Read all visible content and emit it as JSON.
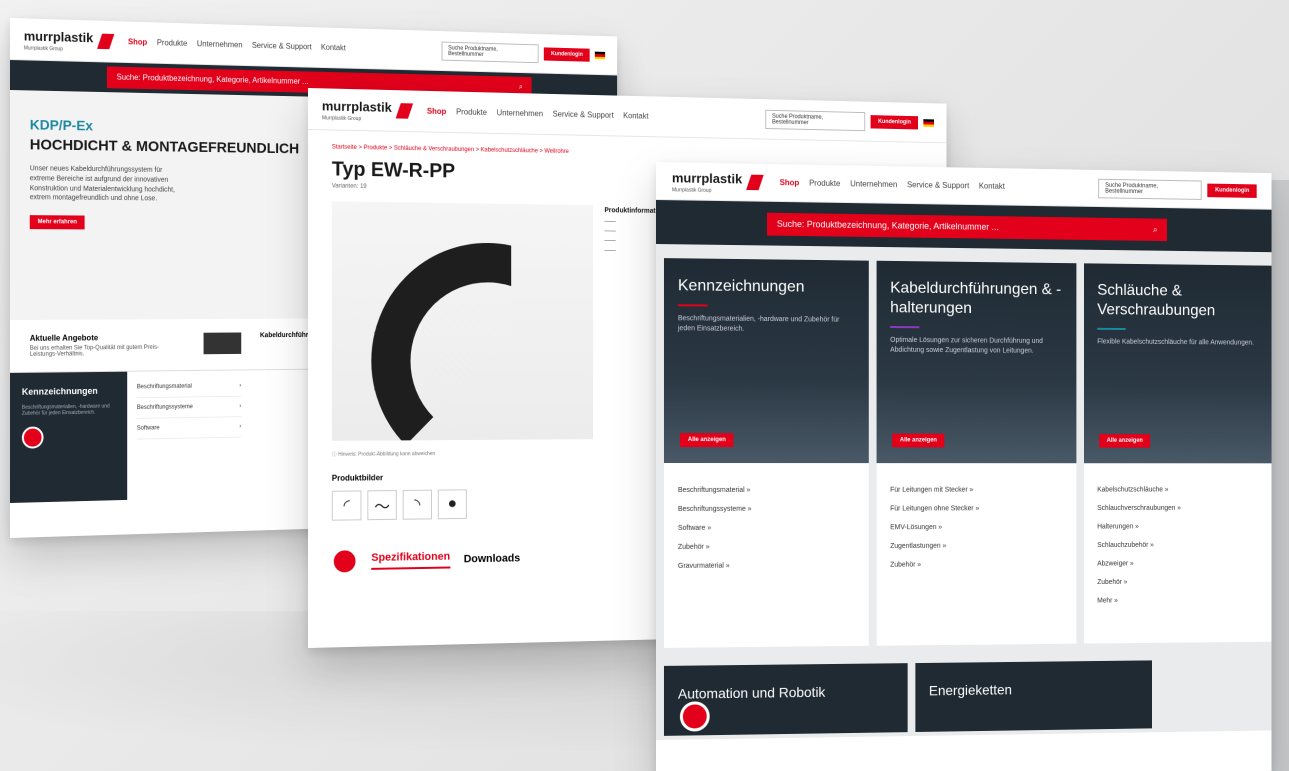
{
  "header": {
    "logo": "murrplastik",
    "logo_sub": "Murrplastik Group",
    "nav": [
      "Shop",
      "Produkte",
      "Unternehmen",
      "Service & Support",
      "Kontakt"
    ],
    "search_placeholder": "Suche Produktname, Bestellnummer",
    "login": "Kundenlogin",
    "flag": "DE"
  },
  "search_bar": "Suche: Produktbezeichnung, Kategorie, Artikelnummer ...",
  "screen1": {
    "tag": "KDP/P-Ex",
    "headline": "HOCHDICHT & MONTAGEFREUNDLICH",
    "text": "Unser neues Kabeldurchführungssystem für extreme Bereiche ist aufgrund der innovativen Konstruktion und Materialentwicklung hochdicht, extrem montagefreundlich und ohne Lose.",
    "cta": "Mehr erfahren",
    "offers_title": "Aktuelle Angebote",
    "offers_text": "Bei uns erhalten Sie Top-Qualität mit gutem Preis-Leistungs-Verhältnis.",
    "offer_product": "Kabeldurchführung Typ KDP/P-Ex",
    "dark_card_title": "Kennzeichnungen",
    "dark_card_text": "Beschriftungsmaterialien, -hardware und Zubehör für jeden Einsatzbereich.",
    "categories": [
      "Beschriftungsmaterial",
      "Beschriftungssysteme",
      "Software"
    ]
  },
  "screen2": {
    "breadcrumb": "Startseite > Produkte > Schläuche & Verschraubungen > Kabelschutzschläuche > Wellrohre",
    "title": "Typ EW-R-PP",
    "variants": "Varianten: 19",
    "product_info_title": "Produktinformationen",
    "hint": "Hinweis: Produkt-Abbildung kann abweichen",
    "images_title": "Produktbilder",
    "thumbs": [
      "◜",
      "〜",
      "◝",
      "●"
    ],
    "tabs": [
      "Spezifikationen",
      "Downloads"
    ]
  },
  "screen3": {
    "cards": [
      {
        "title": "Kennzeichnungen",
        "text": "Beschriftungsmaterialien, -hardware und Zubehör für jeden Einsatzbereich.",
        "cta": "Alle anzeigen",
        "links": [
          "Beschriftungsmaterial »",
          "Beschriftungssysteme »",
          "Software »",
          "Zubehör »",
          "Gravurmaterial »"
        ]
      },
      {
        "title": "Kabeldurchführungen & -halterungen",
        "text": "Optimale Lösungen zur sicheren Durchführung und Abdichtung sowie Zugentlastung von Leitungen.",
        "cta": "Alle anzeigen",
        "links": [
          "Für Leitungen mit Stecker »",
          "Für Leitungen ohne Stecker »",
          "EMV-Lösungen »",
          "Zugentlastungen »",
          "Zubehör »"
        ]
      },
      {
        "title": "Schläuche & Verschraubungen",
        "text": "Flexible Kabelschutzschläuche für alle Anwendungen.",
        "cta": "Alle anzeigen",
        "links": [
          "Kabelschutzschläuche »",
          "Schlauchverschraubungen »",
          "Halterungen »",
          "Schlauchzubehör »",
          "Abzweiger »",
          "Zubehör »",
          "Mehr »"
        ]
      }
    ],
    "bottom_cards": [
      "Automation und Robotik",
      "Energieketten"
    ]
  },
  "colors": {
    "brand_red": "#e2001a",
    "dark": "#1f2a33",
    "accent_teal": "#1b8aa0"
  }
}
